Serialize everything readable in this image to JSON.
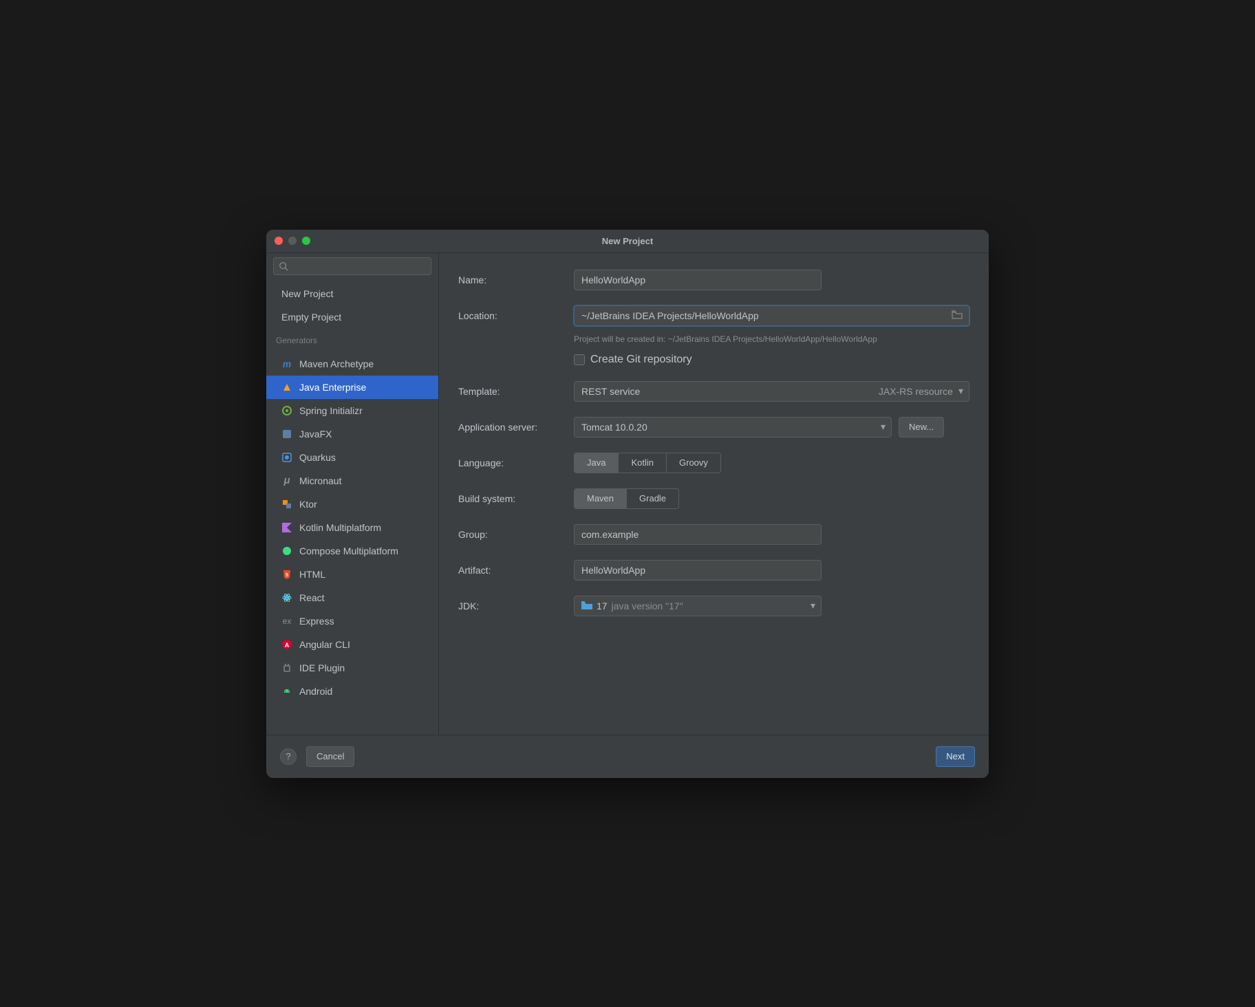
{
  "title": "New Project",
  "sidebar": {
    "top": [
      {
        "label": "New Project"
      },
      {
        "label": "Empty Project"
      }
    ],
    "generators_header": "Generators",
    "generators": [
      {
        "label": "Maven Archetype",
        "icon": "maven",
        "color": "#3b82c4"
      },
      {
        "label": "Java Enterprise",
        "icon": "javaee",
        "color": "#f0a12b",
        "selected": true
      },
      {
        "label": "Spring Initializr",
        "icon": "spring",
        "color": "#6db33f"
      },
      {
        "label": "JavaFX",
        "icon": "javafx",
        "color": "#5b7fa6"
      },
      {
        "label": "Quarkus",
        "icon": "quarkus",
        "color": "#4695eb"
      },
      {
        "label": "Micronaut",
        "icon": "micronaut",
        "color": "#8a9199"
      },
      {
        "label": "Ktor",
        "icon": "ktor",
        "color": "#f28c1d"
      },
      {
        "label": "Kotlin Multiplatform",
        "icon": "kotlin",
        "color": "#b36ae2"
      },
      {
        "label": "Compose Multiplatform",
        "icon": "compose",
        "color": "#3ddc84"
      },
      {
        "label": "HTML",
        "icon": "html",
        "color": "#e44d26"
      },
      {
        "label": "React",
        "icon": "react",
        "color": "#61dafb"
      },
      {
        "label": "Express",
        "icon": "express",
        "color": "#8a9199"
      },
      {
        "label": "Angular CLI",
        "icon": "angular",
        "color": "#dd0031"
      },
      {
        "label": "IDE Plugin",
        "icon": "ideplugin",
        "color": "#8a9199"
      },
      {
        "label": "Android",
        "icon": "android",
        "color": "#3ddc84"
      }
    ]
  },
  "form": {
    "name_label": "Name:",
    "name": "HelloWorldApp",
    "location_label": "Location:",
    "location": "~/JetBrains IDEA Projects/HelloWorldApp",
    "location_hint": "Project will be created in: ~/JetBrains IDEA Projects/HelloWorldApp/HelloWorldApp",
    "git_label": "Create Git repository",
    "template_label": "Template:",
    "template_value": "REST service",
    "template_right": "JAX-RS resource",
    "appserver_label": "Application server:",
    "appserver_value": "Tomcat 10.0.20",
    "appserver_new": "New...",
    "language_label": "Language:",
    "language_options": [
      "Java",
      "Kotlin",
      "Groovy"
    ],
    "build_label": "Build system:",
    "build_options": [
      "Maven",
      "Gradle"
    ],
    "group_label": "Group:",
    "group": "com.example",
    "artifact_label": "Artifact:",
    "artifact": "HelloWorldApp",
    "jdk_label": "JDK:",
    "jdk_value": "17",
    "jdk_desc": "java version \"17\""
  },
  "footer": {
    "cancel": "Cancel",
    "next": "Next"
  }
}
